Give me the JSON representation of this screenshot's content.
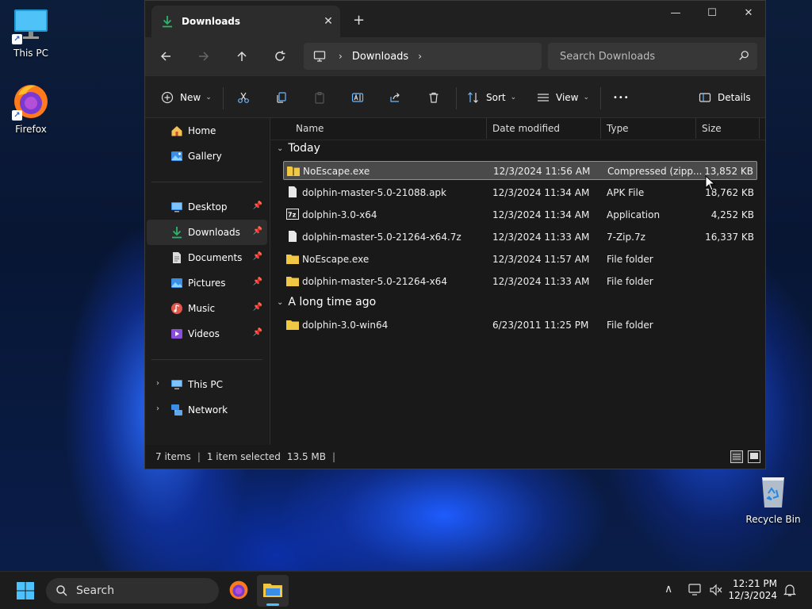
{
  "desktop": {
    "icons": [
      {
        "label": "This PC",
        "icon": "monitor-icon"
      },
      {
        "label": "Firefox",
        "icon": "firefox-icon"
      },
      {
        "label": "Recycle Bin",
        "icon": "recycle-bin-icon"
      }
    ],
    "shortcut_glyph": "↗"
  },
  "window": {
    "tab_title": "Downloads",
    "tab_close": "✕",
    "new_tab": "+",
    "controls": {
      "minimize": "—",
      "maximize": "☐",
      "close": "✕"
    },
    "address": {
      "crumbs": [
        "Downloads"
      ],
      "separator": "›"
    },
    "search_placeholder": "Search Downloads",
    "commands": {
      "new": "New",
      "sort": "Sort",
      "view": "View",
      "more": "•••",
      "details": "Details",
      "chevron": "⌄"
    },
    "sidebar": {
      "quick": [
        {
          "label": "Home",
          "icon": "home-icon"
        },
        {
          "label": "Gallery",
          "icon": "gallery-icon"
        }
      ],
      "pinned": [
        {
          "label": "Desktop",
          "icon": "desktop-folder-icon"
        },
        {
          "label": "Downloads",
          "icon": "downloads-folder-icon",
          "selected": true
        },
        {
          "label": "Documents",
          "icon": "documents-folder-icon"
        },
        {
          "label": "Pictures",
          "icon": "pictures-folder-icon"
        },
        {
          "label": "Music",
          "icon": "music-folder-icon"
        },
        {
          "label": "Videos",
          "icon": "videos-folder-icon"
        }
      ],
      "locations": [
        {
          "label": "This PC",
          "icon": "this-pc-icon"
        },
        {
          "label": "Network",
          "icon": "network-icon"
        }
      ],
      "expand_glyph": "›"
    },
    "columns": {
      "name": "Name",
      "date": "Date modified",
      "type": "Type",
      "size": "Size"
    },
    "groups": [
      {
        "label": "Today",
        "files": [
          {
            "name": "NoEscape.exe",
            "date": "12/3/2024 11:56 AM",
            "type": "Compressed (zipp...",
            "size": "13,852 KB",
            "icon": "zip-folder-icon",
            "selected": true
          },
          {
            "name": "dolphin-master-5.0-21088.apk",
            "date": "12/3/2024 11:34 AM",
            "type": "APK File",
            "size": "18,762 KB",
            "icon": "file-icon"
          },
          {
            "name": "dolphin-3.0-x64",
            "date": "12/3/2024 11:34 AM",
            "type": "Application",
            "size": "4,252 KB",
            "icon": "7z-app-icon"
          },
          {
            "name": "dolphin-master-5.0-21264-x64.7z",
            "date": "12/3/2024 11:33 AM",
            "type": "7-Zip.7z",
            "size": "16,337 KB",
            "icon": "file-icon"
          },
          {
            "name": "NoEscape.exe",
            "date": "12/3/2024 11:57 AM",
            "type": "File folder",
            "size": "",
            "icon": "folder-icon"
          },
          {
            "name": "dolphin-master-5.0-21264-x64",
            "date": "12/3/2024 11:33 AM",
            "type": "File folder",
            "size": "",
            "icon": "folder-icon"
          }
        ]
      },
      {
        "label": "A long time ago",
        "files": [
          {
            "name": "dolphin-3.0-win64",
            "date": "6/23/2011 11:25 PM",
            "type": "File folder",
            "size": "",
            "icon": "folder-icon"
          }
        ]
      }
    ],
    "status": {
      "count": "7 items",
      "selection": "1 item selected",
      "size": "13.5 MB",
      "sep": "|"
    }
  },
  "taskbar": {
    "search_label": "Search",
    "time": "12:21 PM",
    "date": "12/3/2024",
    "tray_chevron": "∧"
  },
  "colors": {
    "window_bg": "#191919",
    "selection_bg": "#4a4a4a",
    "folder_yellow": "#f2c744",
    "accent_green": "#2fb36b",
    "accent_blue": "#3a8ee6"
  }
}
